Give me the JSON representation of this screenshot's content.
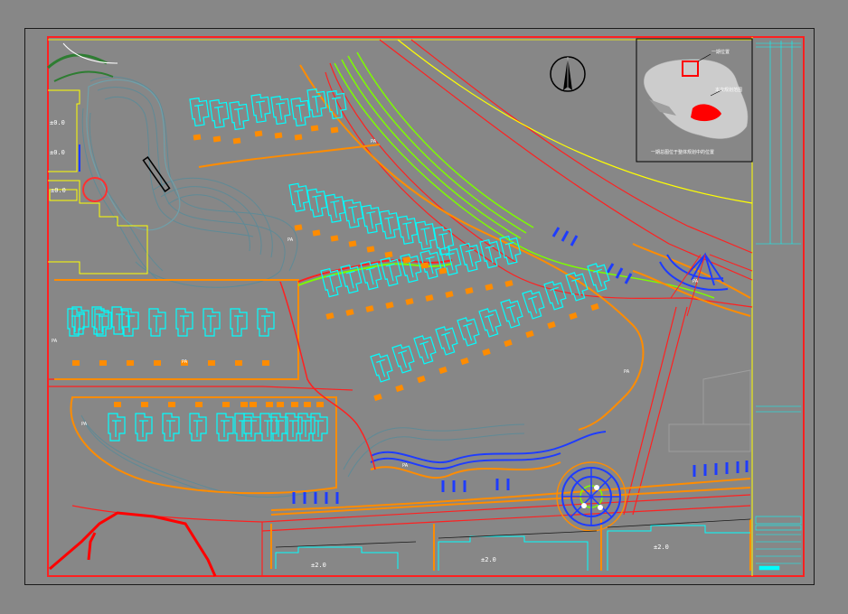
{
  "labels": {
    "left_elev_1": "±0.0",
    "left_elev_2": "±0.0",
    "left_elev_3": "±0.0",
    "south_elev_1": "±2.0",
    "south_elev_2": "±2.0",
    "south_elev_3": "±2.0",
    "pa": "PA"
  },
  "inset": {
    "caption": "一期总图位于整体规划中的位置",
    "callout_1": "一期位置",
    "callout_2": "本次规划范围"
  },
  "colors": {
    "background": "#878787",
    "border": "#ff2020",
    "building": "#00ffff",
    "road": "#ff8c00",
    "green": "#7cfc00",
    "contour": "#5f7f8a",
    "roundabout": "#1e3cff",
    "yellow": "#ffff00"
  },
  "icons": [
    "north-arrow-icon"
  ]
}
